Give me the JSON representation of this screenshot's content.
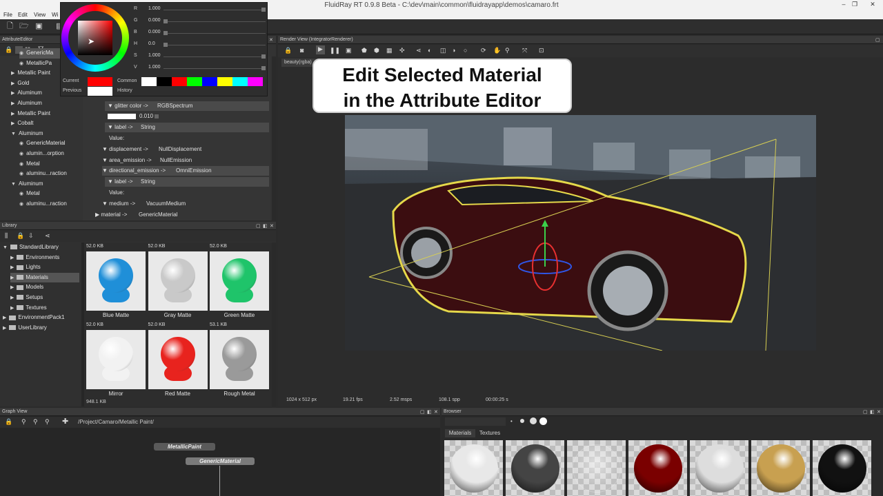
{
  "window": {
    "title": "FluidRay RT 0.9.8 Beta - C:\\dev\\main\\common\\fluidrayapp\\demos\\camaro.frt",
    "min": "–",
    "max": "❐",
    "close": "✕"
  },
  "menu": [
    "File",
    "Edit",
    "View",
    "Wi"
  ],
  "attribute_editor": {
    "title": "AttributeEditor",
    "tree": [
      {
        "label": "GenericMa",
        "indent": 2,
        "arrow": ""
      },
      {
        "label": "MetallicPa",
        "indent": 2,
        "arrow": ""
      },
      {
        "label": "Metallic Paint",
        "indent": 1,
        "arrow": "▶"
      },
      {
        "label": "Gold",
        "indent": 1,
        "arrow": "▶"
      },
      {
        "label": "Aluminum",
        "indent": 1,
        "arrow": "▶"
      },
      {
        "label": "Aluminum",
        "indent": 1,
        "arrow": "▶"
      },
      {
        "label": "Metallic Paint",
        "indent": 1,
        "arrow": "▶"
      },
      {
        "label": "Cobalt",
        "indent": 1,
        "arrow": "▶"
      },
      {
        "label": "Aluminum",
        "indent": 1,
        "arrow": "▼"
      },
      {
        "label": "GenericMaterial",
        "indent": 2,
        "arrow": ""
      },
      {
        "label": "alumin...orption",
        "indent": 2,
        "arrow": ""
      },
      {
        "label": "Metal",
        "indent": 2,
        "arrow": ""
      },
      {
        "label": "aluminu...raction",
        "indent": 2,
        "arrow": ""
      },
      {
        "label": "Aluminum",
        "indent": 1,
        "arrow": "▼"
      },
      {
        "label": "Metal",
        "indent": 2,
        "arrow": ""
      },
      {
        "label": "aluminu...raction",
        "indent": 2,
        "arrow": ""
      }
    ],
    "attrs": {
      "glitter_color": "▼ glitter color ->",
      "glitter_color_type": "RGBSpectrum",
      "glitter_value": "0.010",
      "label1": "▼ label ->",
      "label1_type": "String",
      "value1": "Value:",
      "displacement": "▼ displacement ->",
      "displacement_type": "NullDisplacement",
      "area_emission": "▼ area_emission ->",
      "area_emission_type": "NullEmission",
      "directional_emission": "▼ directional_emission ->",
      "directional_emission_type": "OmniEmission",
      "label2": "▼ label ->",
      "label2_type": "String",
      "value2": "Value:",
      "medium": "▼ medium ->",
      "medium_type": "VacuumMedium",
      "material": "▶ material ->",
      "material_type": "GenericMaterial"
    }
  },
  "color_picker": {
    "sliders": [
      {
        "label": "R",
        "value": "1.000",
        "level": 1.0
      },
      {
        "label": "G",
        "value": "0.000",
        "level": 0.0
      },
      {
        "label": "B",
        "value": "0.000",
        "level": 0.0
      },
      {
        "label": "H",
        "value": "0.0",
        "level": 0.0
      },
      {
        "label": "S",
        "value": "1.000",
        "level": 1.0
      },
      {
        "label": "V",
        "value": "1.000",
        "level": 1.0
      }
    ],
    "current_label": "Current",
    "previous_label": "Previous",
    "common_label": "Common",
    "history_label": "History",
    "current_color": "#ff0000",
    "previous_color": "#ffffff",
    "common_colors": [
      "#ffffff",
      "#000000",
      "#ff0000",
      "#00ff00",
      "#0000ff",
      "#ffff00",
      "#00ffff",
      "#ff00ff"
    ]
  },
  "library": {
    "title": "Library",
    "tree": [
      {
        "label": "StandardLibrary",
        "indent": 0,
        "arrow": "▼"
      },
      {
        "label": "Environments",
        "indent": 1,
        "arrow": "▶"
      },
      {
        "label": "Lights",
        "indent": 1,
        "arrow": "▶"
      },
      {
        "label": "Materials",
        "indent": 1,
        "arrow": "▶"
      },
      {
        "label": "Models",
        "indent": 1,
        "arrow": "▶"
      },
      {
        "label": "Setups",
        "indent": 1,
        "arrow": "▶"
      },
      {
        "label": "Textures",
        "indent": 1,
        "arrow": "▶"
      },
      {
        "label": "EnvironmentPack1",
        "indent": 0,
        "arrow": "▶"
      },
      {
        "label": "UserLibrary",
        "indent": 0,
        "arrow": "▶"
      }
    ],
    "items": [
      {
        "size": "52.0 KB",
        "name": "Blue Matte",
        "color": "#1f8fd8"
      },
      {
        "size": "52.0 KB",
        "name": "Gray Matte",
        "color": "#c9c9c9"
      },
      {
        "size": "52.0 KB",
        "name": "Green Matte",
        "color": "#1fc46a"
      },
      {
        "size": "52.0 KB",
        "name": "Mirror",
        "color": "#f2f2f2"
      },
      {
        "size": "52.0 KB",
        "name": "Red Matte",
        "color": "#e8231e"
      },
      {
        "size": "53.1 KB",
        "name": "Rough Metal",
        "color": "#9a9a9a"
      }
    ],
    "footer": "948.1 KB"
  },
  "render_view": {
    "title": "Render View (IntegratorRenderer)",
    "tab": "beauty(rgba)",
    "callout_line1": "Edit Selected Material",
    "callout_line2": "in the Attribute Editor",
    "status": {
      "resolution": "1024 x 512 px",
      "fps": "19.21 fps",
      "msps": "2.52 msps",
      "spp": "108.1 spp",
      "time": "00:00:25 s"
    }
  },
  "graph_view": {
    "title": "Graph View",
    "path": "/Project/Camaro/Metallic Paint/",
    "node1": "MetallicPaint",
    "node2": "GenericMaterial"
  },
  "browser": {
    "title": "Browser",
    "tabs": [
      "Materials",
      "Textures"
    ],
    "balls": [
      "#e8e8e8",
      "#444444",
      "checker",
      "#7a0000",
      "#dddddd",
      "#c8a050",
      "#111111"
    ]
  }
}
